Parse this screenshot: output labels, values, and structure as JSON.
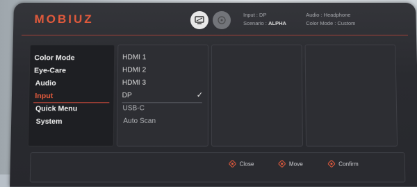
{
  "brand": {
    "logo_text": "MOBIUZ",
    "accent": "#e25a3c"
  },
  "header": {
    "icons": [
      "display-settings-icon",
      "game-mode-icon"
    ],
    "status": {
      "input_label": "Input : DP",
      "scenario_label": "Scenario :",
      "scenario_value": "ALPHA",
      "audio_label": "Audio : Headphone",
      "color_mode_label": "Color Mode : Custom"
    }
  },
  "menu": {
    "items": [
      {
        "label": "Color Mode",
        "active": false
      },
      {
        "label": "Eye-Care",
        "active": false
      },
      {
        "label": "Audio",
        "active": false
      },
      {
        "label": "Input",
        "active": true
      },
      {
        "label": "Quick Menu",
        "active": false
      },
      {
        "label": "System",
        "active": false
      }
    ]
  },
  "submenu": {
    "items": [
      {
        "label": "HDMI 1",
        "selected": false
      },
      {
        "label": "HDMI 2",
        "selected": false
      },
      {
        "label": "HDMI 3",
        "selected": false
      },
      {
        "label": "DP",
        "selected": true
      },
      {
        "label": "USB-C",
        "selected": false
      },
      {
        "label": "Auto Scan",
        "selected": false
      }
    ],
    "check_glyph": "✓"
  },
  "footer": {
    "close_label": "Close",
    "move_label": "Move",
    "confirm_label": "Confirm"
  }
}
